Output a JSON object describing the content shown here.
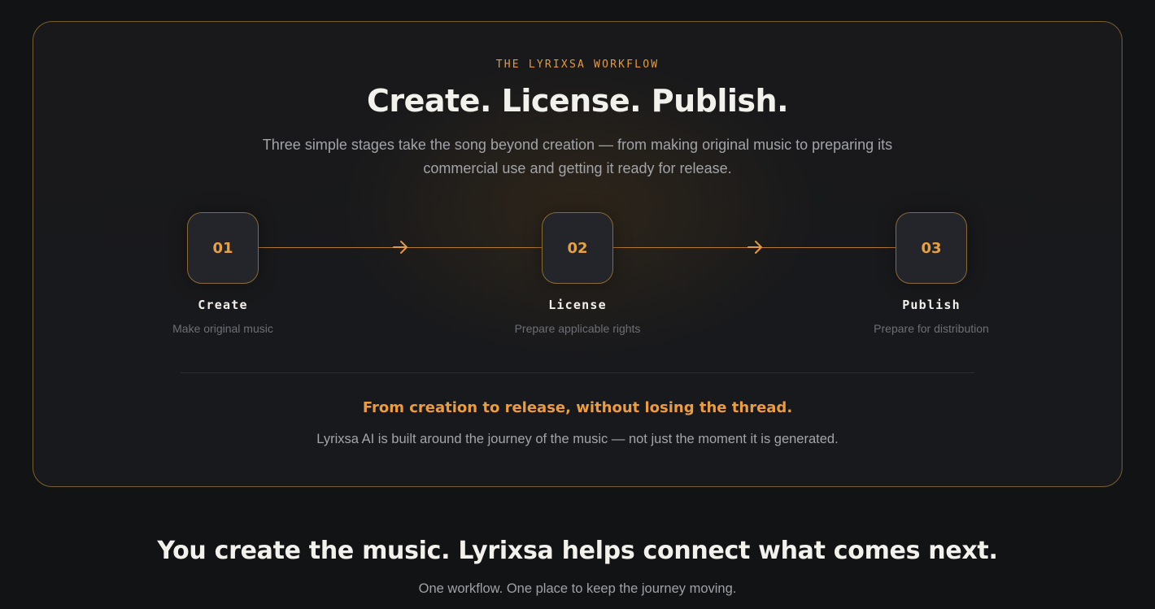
{
  "workflow": {
    "eyebrow": "THE LYRIXSA WORKFLOW",
    "title": "Create. License. Publish.",
    "description": "Three simple stages take the song beyond creation — from making original music to preparing its commercial use and getting it ready for release.",
    "steps": [
      {
        "number": "01",
        "name": "Create",
        "subtitle": "Make original music"
      },
      {
        "number": "02",
        "name": "License",
        "subtitle": "Prepare applicable rights"
      },
      {
        "number": "03",
        "name": "Publish",
        "subtitle": "Prepare for distribution"
      }
    ],
    "highlight": "From creation to release, without losing the thread.",
    "note": "Lyrixsa AI is built around the journey of the music — not just the moment it is generated."
  },
  "next_section": {
    "title": "You create the music. Lyrixsa helps connect what comes next.",
    "subtitle": "One workflow. One place to keep the journey moving."
  },
  "colors": {
    "accent": "#e49a38",
    "background": "#121315",
    "card_border": "#7a5f2e"
  }
}
